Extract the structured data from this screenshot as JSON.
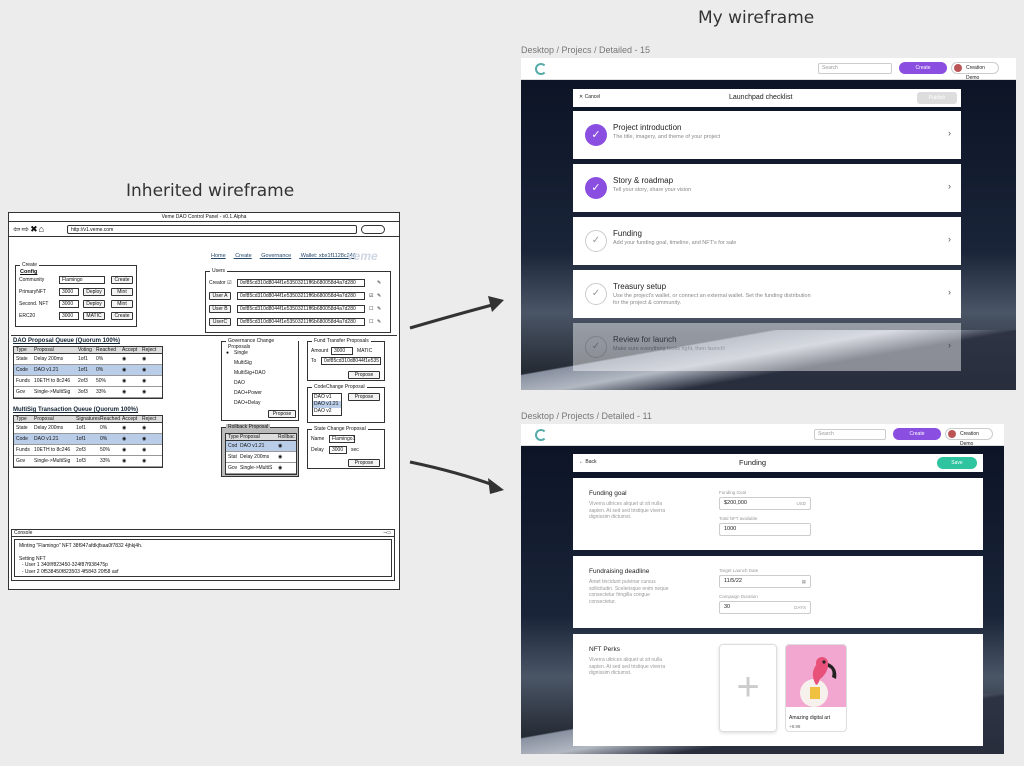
{
  "titles": {
    "my": "My wireframe",
    "inherited": "Inherited wireframe"
  },
  "inherited": {
    "window_title": "Veme DAO Control Panel - v0.1.Alpha",
    "url": "http://v1.veme.com",
    "links": [
      "Home",
      "Create",
      "Governance",
      "Wallet: xbx1f1128c246"
    ],
    "brand": "veme",
    "create": {
      "legend": "Create",
      "heading": "Config",
      "rows": [
        {
          "label": "Community",
          "field": "Flamingo",
          "btn1": "Create",
          "btn2": ""
        },
        {
          "label": "PrimaryNFT",
          "field": "3000",
          "btn1": "Deploy",
          "btn2": "Mint"
        },
        {
          "label": "Second. NFT",
          "field": "3000",
          "btn1": "Deploy",
          "btn2": "Mint"
        },
        {
          "label": "ERC20",
          "field": "3000",
          "btn1": "MATIC",
          "btn2": "Create"
        }
      ]
    },
    "users": {
      "legend": "Users",
      "rows": [
        {
          "label": "Creator",
          "addr": "0xf85cd310d8044f1e53503211ff6b680058d4a7d280",
          "check": "☑"
        },
        {
          "label": "User A",
          "addr": "0xf85cd310d8044f1e53503211ff6b680058d4a7d280",
          "check": "☑"
        },
        {
          "label": "User B",
          "addr": "0xf85cd310d8044f1e53503211ff6b680058d4a7d280",
          "check": "☐"
        },
        {
          "label": "UserC",
          "addr": "0xf85cd310d8044f1e53503211ff6b680058d4a7d280",
          "check": "☐"
        }
      ]
    },
    "dao_queue": {
      "title": "DAO Proposal Queue (Quorum 100%)",
      "headers": [
        "Type",
        "Proposal",
        "Voting",
        "Reached",
        "Accept",
        "Reject"
      ],
      "rows": [
        [
          "State",
          "Delay 200ms",
          "1of1",
          "0%",
          "◉",
          "◉"
        ],
        [
          "Code",
          "DAO v1.21",
          "1of1",
          "0%",
          "◉",
          "◉"
        ],
        [
          "Funds",
          "10ETH to 8c246",
          "2of3",
          "50%",
          "◉",
          "◉"
        ],
        [
          "Gov",
          "Single->MultiSig",
          "3of3",
          "33%",
          "◉",
          "◉"
        ]
      ]
    },
    "multisig_queue": {
      "title": "MultiSig Transaction Queue (Quorum 100%)",
      "headers": [
        "Type",
        "Proposal",
        "Signatures",
        "Reached",
        "Accept",
        "Reject"
      ],
      "rows": [
        [
          "State",
          "Delay 200ms",
          "1of1",
          "0%",
          "◉",
          "◉"
        ],
        [
          "Code",
          "DAO v1.21",
          "1of1",
          "0%",
          "◉",
          "◉"
        ],
        [
          "Funds",
          "10ETH to 8c246",
          "2of3",
          "50%",
          "◉",
          "◉"
        ],
        [
          "Gov",
          "Single->MultiSig",
          "1of3",
          "33%",
          "◉",
          "◉"
        ]
      ]
    },
    "gov_change": {
      "legend": "Governance Change Proposals",
      "options": [
        "Single",
        "MultiSig",
        "MultiSig+DAO",
        "DAO",
        "DAO+Power",
        "DAO+Delay"
      ],
      "propose": "Propose"
    },
    "rollback": {
      "legend": "Rollback Proposal",
      "headers": [
        "Type",
        "Proposal",
        "Rollbac"
      ],
      "rows": [
        [
          "Cod",
          "DAO v1.21",
          "◉"
        ],
        [
          "Stat",
          "Delay 200ms",
          "◉"
        ],
        [
          "Gov",
          "Single->MultiS",
          "◉"
        ]
      ]
    },
    "fund_transfer": {
      "legend": "Fund Transfer Proposals",
      "amount_label": "Amount",
      "amount": "3000",
      "unit": "MATIC",
      "to_label": "To",
      "to": "0xf85cd310d8044f1e535",
      "propose": "Propose"
    },
    "code_change": {
      "legend": "CodeChange Proposal",
      "versions": [
        "DAO v1",
        "DAO v1.21",
        "DAO v2"
      ],
      "propose": "Propose"
    },
    "state_change": {
      "legend": "State Change Proposal",
      "name_label": "Name",
      "name": "Flamingo1",
      "delay_label": "Delay",
      "delay": "3000",
      "unit": "sec",
      "propose": "Propose"
    },
    "console": {
      "title": "Console",
      "lines": [
        "Minting \"Flamingo\" NFT 38f947afdkjfsaa0f7832 4jhkj4h.",
        "",
        "Setting NFT",
        "  - User 1 340f/f823450-324f87f938475p",
        "  - User 2 0f538450f823503 4f5843 20f58 asf"
      ]
    }
  },
  "launchpad": {
    "breadcrumb": "Desktop / Projecs / Detailed - 15",
    "search_placeholder": "Search",
    "create": "Create",
    "user": "Creation Demo",
    "cancel": "Cancel",
    "header": "Launchpad checklist",
    "publish": "Publish",
    "items": [
      {
        "title": "Project introduction",
        "subtitle": "The title, imagery, and theme of your project",
        "done": true
      },
      {
        "title": "Story & roadmap",
        "subtitle": "Tell your story, share your vision",
        "done": true
      },
      {
        "title": "Funding",
        "subtitle": "Add your funding goal, timeline, and NFT's for sale",
        "done": false
      },
      {
        "title": "Treasury setup",
        "subtitle": "Use the project's wallet, or connect an external wallet. Set the funding distribution for the project & community.",
        "done": false
      },
      {
        "title": "Review for launch",
        "subtitle": "Make sure everything looks right, then launch!",
        "done": false
      }
    ]
  },
  "funding": {
    "breadcrumb": "Desktop / Projects / Detailed - 11",
    "search_placeholder": "Search",
    "create": "Create",
    "user": "Creation Demo",
    "back": "Back",
    "header": "Funding",
    "save": "Save",
    "sections": {
      "goal": {
        "title": "Funding goal",
        "desc": "Viverra ultrices aliquet ut sit nulla sapien. At sed sed tristique viverra dignissim dictumst.",
        "f1_label": "Funding Goal",
        "f1": "$200,000",
        "f1_suffix": "USD",
        "f2_label": "Total NFT available",
        "f2": "1000"
      },
      "deadline": {
        "title": "Fundraising deadline",
        "desc": "Amet tincidunt pulvinar cursus sollicitudin. Scelerisque enim neque consectetur fringilla congue consectetur.",
        "f1_label": "Target Launch Date",
        "f1": "11/5/22",
        "f2_label": "Campaign Duration",
        "f2": "30",
        "f2_suffix": "DAYS"
      },
      "perks": {
        "title": "NFT Perks",
        "desc": "Viverra ultrices aliquet ut sit nulla sapien. At sed sed tristique viverra dignissim dictumst.",
        "card_title": "Amazing digital art",
        "card_price": "+8.99"
      }
    }
  }
}
